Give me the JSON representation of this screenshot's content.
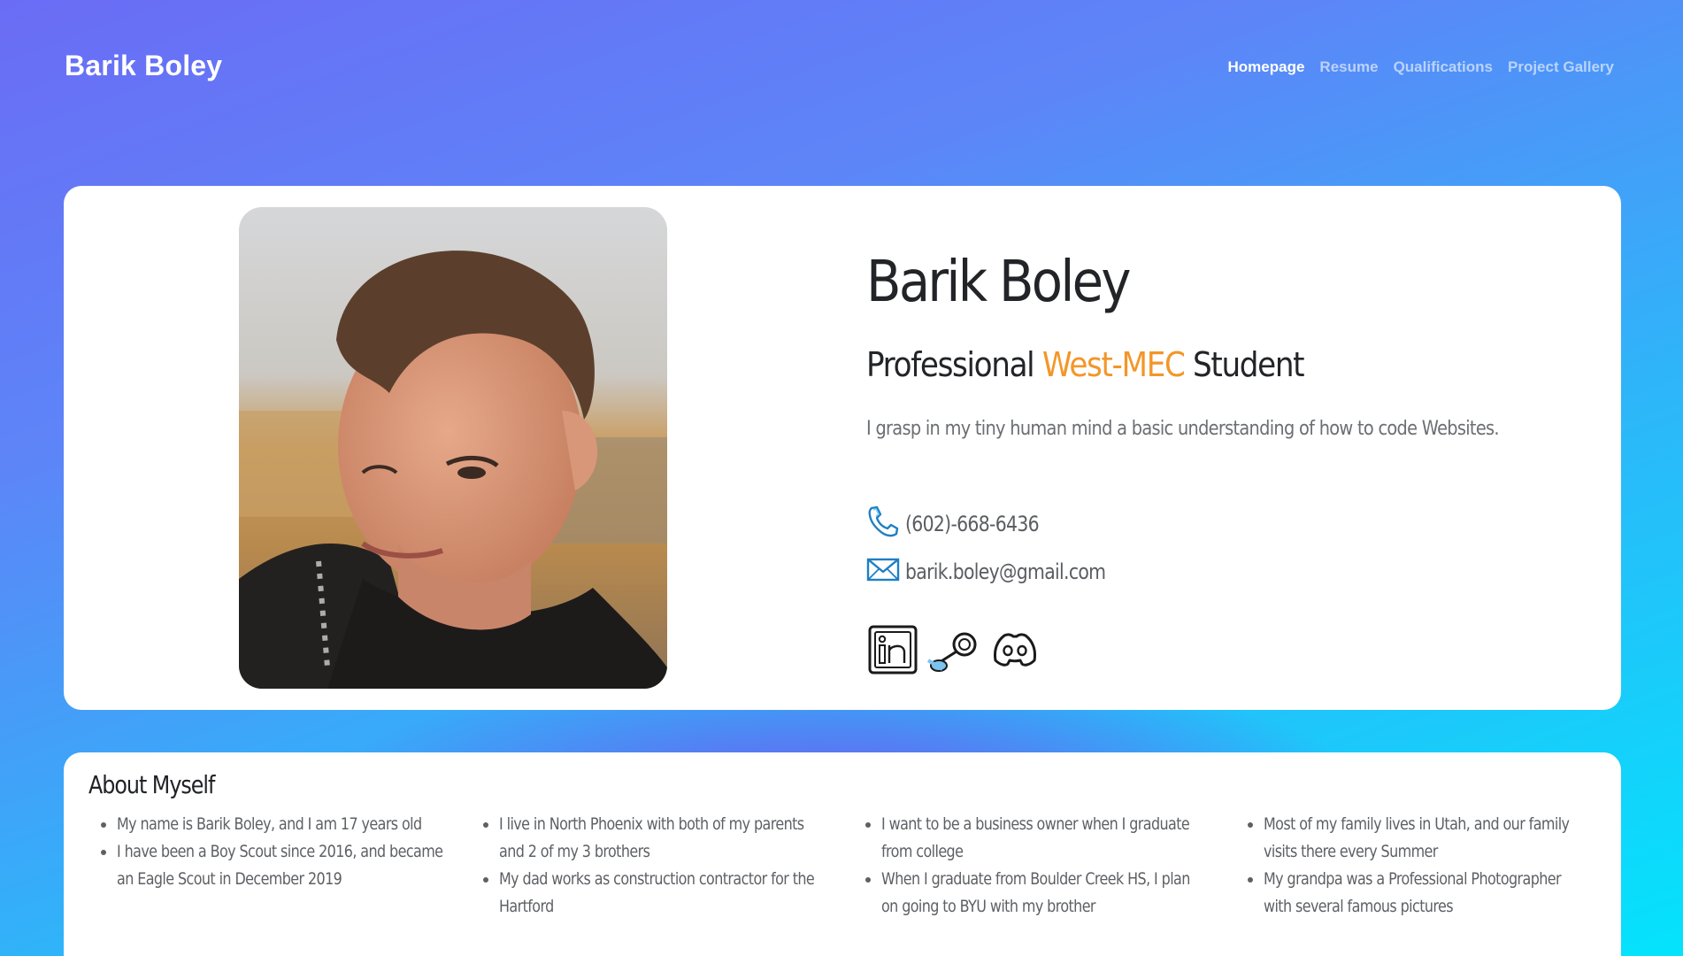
{
  "brand": "Barik Boley",
  "nav": {
    "items": [
      "Homepage",
      "Resume",
      "Qualifications",
      "Project Gallery"
    ],
    "active": "Homepage"
  },
  "profile": {
    "name": "Barik Boley",
    "tagline_prefix": "Professional",
    "tagline_highlight": "West-MEC",
    "tagline_suffix": "Student",
    "blurb": "I grasp in my tiny human mind a basic understanding of how to code Websites.",
    "phone": "(602)-668-6436",
    "email": "barik.boley@gmail.com",
    "social_icons": [
      "linkedin-icon",
      "steam-icon",
      "discord-icon"
    ]
  },
  "about": {
    "title": "About Myself",
    "columns": [
      [
        "My name is Barik Boley, and I am 17 years old",
        "I have been a Boy Scout since 2016, and became an Eagle Scout in December 2019"
      ],
      [
        "I live in North Phoenix with both of my parents and 2 of my 3 brothers",
        "My dad works as construction contractor for the Hartford"
      ],
      [
        "I want to be a business owner when I graduate from college",
        "When I graduate from Boulder Creek HS, I plan on going to BYU with my brother"
      ],
      [
        "Most of my family lives in Utah, and our family visits there every Summer",
        "My grandpa was a Professional Photographer with several famous pictures"
      ]
    ]
  },
  "colors": {
    "accent": "#f39629",
    "gradient_start": "#6a6cf5",
    "gradient_end": "#04e3fc",
    "icon_blue": "#1f7fc4"
  }
}
